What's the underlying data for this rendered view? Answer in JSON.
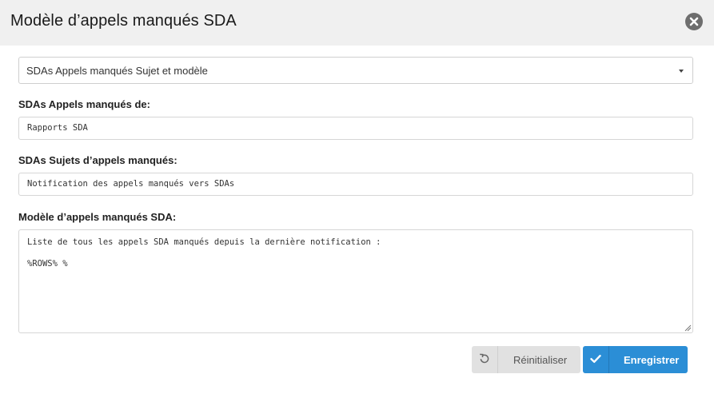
{
  "dialog": {
    "title": "Modèle d’appels manqués SDA",
    "close_icon": "close-icon"
  },
  "form": {
    "template_select": {
      "value": "SDAs Appels manqués Sujet et modèle",
      "icon": "caret-down-icon"
    },
    "from": {
      "label": "SDAs Appels manqués de:",
      "value": "Rapports SDA"
    },
    "subject": {
      "label": "SDAs Sujets d’appels manqués:",
      "value": "Notification des appels manqués vers SDAs"
    },
    "body": {
      "label": "Modèle d’appels manqués SDA:",
      "lines": [
        "Liste de tous les appels SDA manqués depuis la dernière notification :",
        "%ROWS% %"
      ]
    }
  },
  "actions": {
    "reset_label": "Réinitialiser",
    "reset_icon": "undo-icon",
    "save_label": "Enregistrer",
    "save_icon": "check-icon"
  },
  "colors": {
    "header_bg": "#f0f0f0",
    "primary": "#2b8ed6",
    "secondary": "#e1e1e1"
  }
}
